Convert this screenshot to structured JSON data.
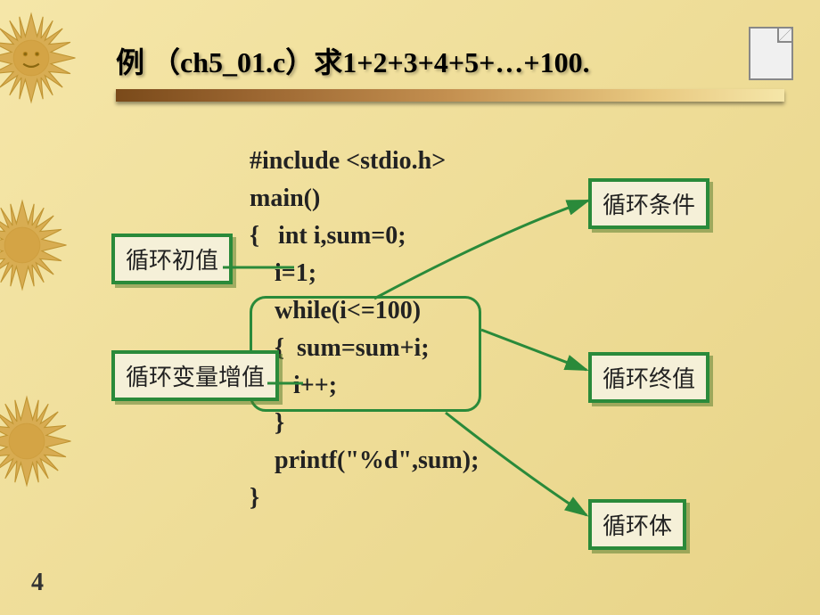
{
  "title": "例 （ch5_01.c）求1+2+3+4+5+…+100.",
  "code": {
    "line1": "#include <stdio.h>",
    "line2": "main()",
    "line3": "{   int i,sum=0;",
    "line4": "    i=1;",
    "line5": "    while(i<=100)",
    "line6": "    {  sum=sum+i;",
    "line7": "       i++;",
    "line8": "    }",
    "line9": "    printf(\"%d\",sum);",
    "line10": "}"
  },
  "labels": {
    "loopInit": "循环初值",
    "loopIncrement": "循环变量增值",
    "loopCondition": "循环条件",
    "loopEnd": "循环终值",
    "loopBody": "循环体"
  },
  "pageNumber": "4"
}
